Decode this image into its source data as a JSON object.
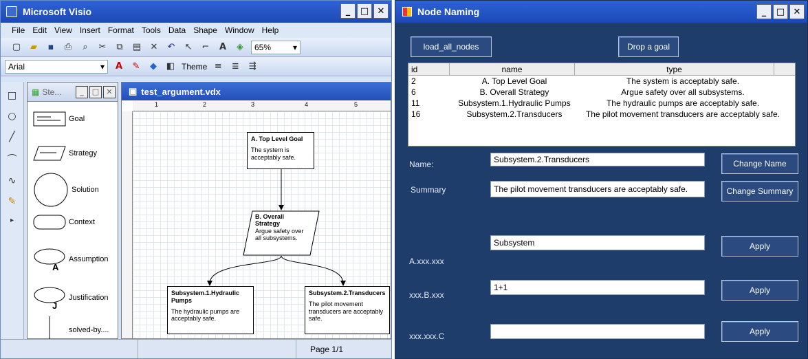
{
  "visio": {
    "title": "Microsoft Visio",
    "menu": [
      "File",
      "Edit",
      "View",
      "Insert",
      "Format",
      "Tools",
      "Data",
      "Shape",
      "Window",
      "Help"
    ],
    "zoom": "65%",
    "font": "Arial",
    "theme_label": "Theme",
    "stencil_title": "Ste...",
    "shapes": [
      "Goal",
      "Strategy",
      "Solution",
      "Context",
      "Assumption",
      "Justification",
      "solved-by...."
    ],
    "document_title": "test_argument.vdx",
    "ruler_marks": [
      "1",
      "2",
      "3",
      "4",
      "5"
    ],
    "nodes": {
      "a_title": "A. Top Level Goal",
      "a_body": "The system is acceptably safe.",
      "b_title": "B. Overall Strategy",
      "b_body": "Argue safety over all subsystems.",
      "c_title": "Subsystem.1.Hydraulic Pumps",
      "c_body": "The hydraulic pumps are acceptably safe.",
      "d_title": "Subsystem.2.Transducers",
      "d_body": "The pilot movement transducers are acceptably safe."
    },
    "status": "Page 1/1"
  },
  "naming": {
    "title": "Node Naming",
    "load_button": "load_all_nodes",
    "drop_button": "Drop a goal",
    "columns": [
      "id",
      "name",
      "type"
    ],
    "rows": [
      {
        "id": "2",
        "name": "A. Top Level Goal",
        "type": "The system is acceptably safe."
      },
      {
        "id": "6",
        "name": "B. Overall Strategy",
        "type": "Argue safety over all subsystems."
      },
      {
        "id": "11",
        "name": "Subsystem.1.Hydraulic Pumps",
        "type": "The hydraulic pumps are acceptably safe."
      },
      {
        "id": "16",
        "name": "Subsystem.2.Transducers",
        "type": "The pilot movement transducers are acceptably safe."
      }
    ],
    "name_label": "Name:",
    "name_value": "Subsystem.2.Transducers",
    "change_name": "Change Name",
    "summary_label": "Summary",
    "summary_value": "The pilot movement transducers are acceptably safe.",
    "change_summary": "Change Summary",
    "a_label": "A.xxx.xxx",
    "a_value": "Subsystem",
    "b_label": "xxx.B.xxx",
    "b_value": "1+1",
    "c_label": "xxx.xxx.C",
    "c_value": "",
    "apply": "Apply"
  }
}
